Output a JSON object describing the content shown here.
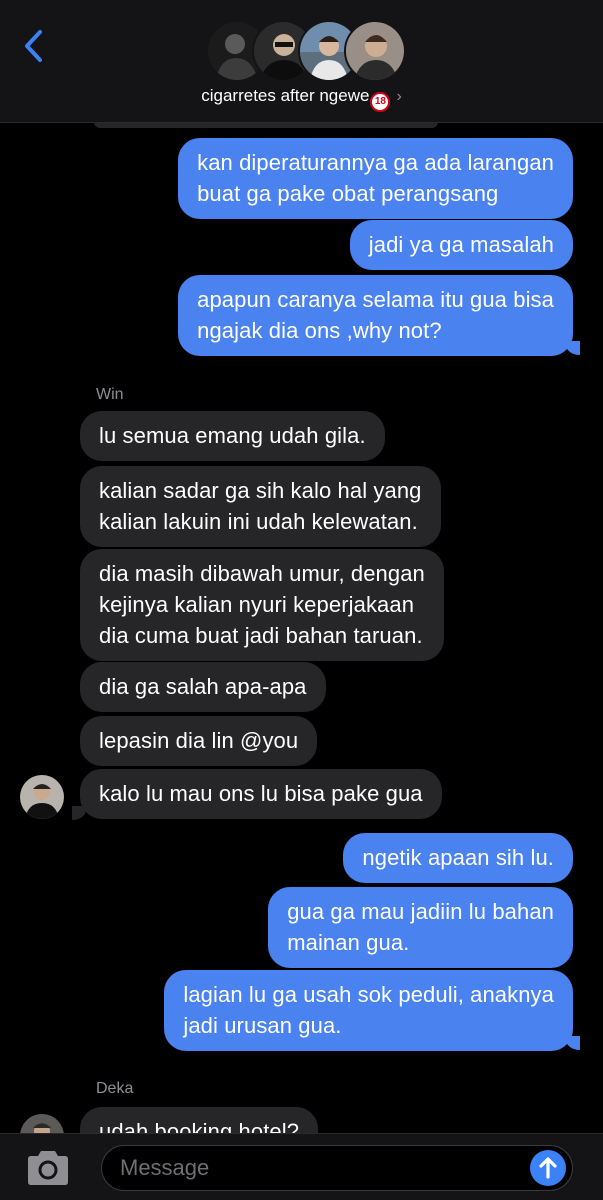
{
  "header": {
    "group_name": "cigarretes after ngewe",
    "age_badge": "18",
    "back_icon": "chevron-left-icon",
    "info_icon": "chevron-right-icon",
    "accent_color": "#3b82f6"
  },
  "messages": [
    {
      "from": "me",
      "lines": [
        "kan diperaturannya ga ada larangan",
        "buat ga pake obat perangsang"
      ]
    },
    {
      "from": "me",
      "lines": [
        "jadi ya ga masalah"
      ]
    },
    {
      "from": "me",
      "lines": [
        "apapun caranya selama itu gua bisa",
        "ngajak dia ons ,why not?"
      ]
    },
    {
      "sender": "Win"
    },
    {
      "from": "Win",
      "lines": [
        "lu semua emang udah gila."
      ]
    },
    {
      "from": "Win",
      "lines": [
        "kalian sadar ga sih kalo hal yang",
        "kalian lakuin ini udah kelewatan."
      ]
    },
    {
      "from": "Win",
      "lines": [
        "dia masih dibawah umur, dengan",
        "kejinya kalian nyuri keperjakaan",
        "dia cuma buat jadi bahan taruan."
      ]
    },
    {
      "from": "Win",
      "lines": [
        "dia ga salah apa-apa"
      ]
    },
    {
      "from": "Win",
      "lines": [
        "lepasin dia lin @you"
      ]
    },
    {
      "from": "Win",
      "lines": [
        "kalo lu mau ons lu bisa pake gua"
      ]
    },
    {
      "from": "me",
      "lines": [
        "ngetik apaan sih lu."
      ]
    },
    {
      "from": "me",
      "lines": [
        "gua ga mau jadiin lu bahan",
        "mainan gua."
      ]
    },
    {
      "from": "me",
      "lines": [
        "lagian lu ga usah sok peduli, anaknya",
        "jadi urusan gua."
      ]
    },
    {
      "sender": "Deka"
    },
    {
      "from": "Deka",
      "lines": [
        "udah booking hotel?"
      ]
    }
  ],
  "composer": {
    "placeholder": "Message",
    "camera_icon": "camera-icon",
    "send_icon": "arrow-up-icon"
  }
}
